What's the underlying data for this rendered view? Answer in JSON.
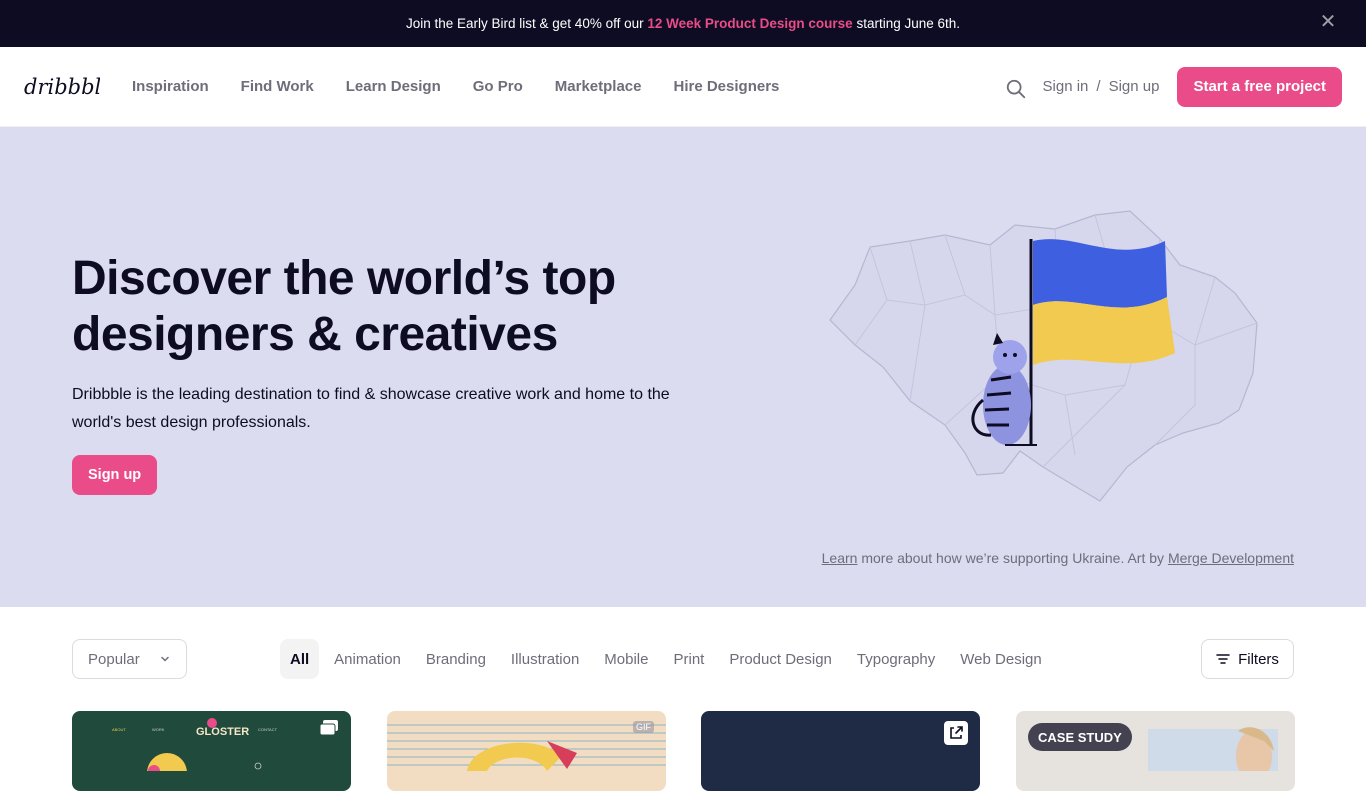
{
  "announcement": {
    "prefix": "Join the Early Bird list & get 40% off our ",
    "highlight": "12 Week Product Design course",
    "suffix": " starting June 6th.",
    "close_icon": "close-icon"
  },
  "header": {
    "logo_text": "dribbble",
    "nav": [
      "Inspiration",
      "Find Work",
      "Learn Design",
      "Go Pro",
      "Marketplace",
      "Hire Designers"
    ],
    "sign_in": "Sign in",
    "separator": "/",
    "sign_up": "Sign up",
    "cta": "Start a free project"
  },
  "hero": {
    "title_line1": "Discover the world’s top",
    "title_line2": "designers & creatives",
    "description": "Dribbble is the leading destination to find & showcase creative work and home to the world's best design professionals.",
    "signup": "Sign up",
    "credit_learn": "Learn",
    "credit_middle": " more about how we’re supporting Ukraine. Art by ",
    "credit_artist": "Merge Development"
  },
  "filters": {
    "sort_value": "Popular",
    "tabs": [
      "All",
      "Animation",
      "Branding",
      "Illustration",
      "Mobile",
      "Print",
      "Product Design",
      "Typography",
      "Web Design"
    ],
    "active_tab": "All",
    "filters_label": "Filters"
  },
  "shots": [
    {
      "badge": "multi-shot-icon",
      "logo": "GLOSTER"
    },
    {
      "badge": "GIF"
    },
    {
      "badge": "external-link-icon"
    },
    {
      "badge": "CASE STUDY"
    }
  ],
  "colors": {
    "accent": "#ea4c89",
    "dark": "#0d0c22",
    "hero_bg": "#dcdcf0",
    "flag_blue": "#3d5fe0",
    "flag_yellow": "#f2ca50"
  }
}
